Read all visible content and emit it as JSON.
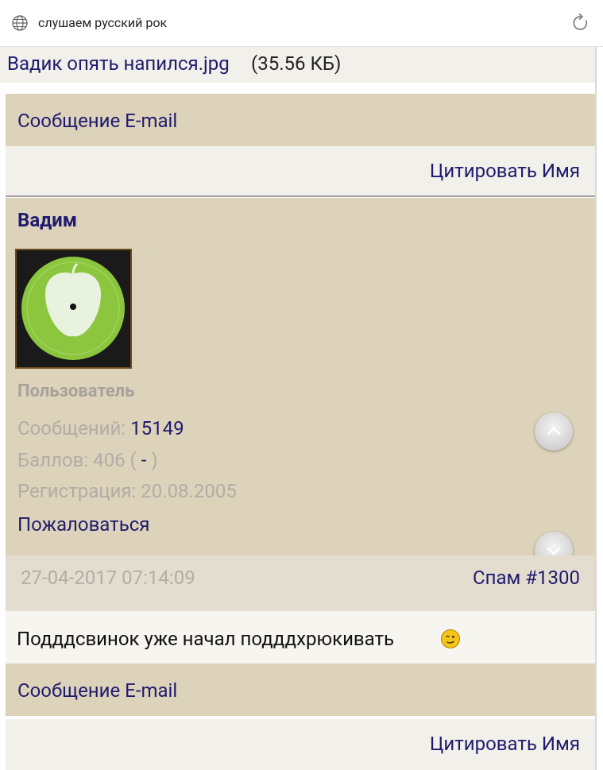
{
  "browser": {
    "url_text": "слушаем русский рок",
    "globe_icon": "globe-icon",
    "reload_icon": "reload-icon"
  },
  "attachment": {
    "filename": "Вадик опять напился.jpg",
    "size": "(35.56 КБ)"
  },
  "post_actions_top": {
    "contact_label": "Сообщение E-mail",
    "quote_label": "Цитировать Имя"
  },
  "author": {
    "name": "Вадим",
    "role": "Пользователь",
    "messages_label": "Сообщений:",
    "messages_value": "15149",
    "points_label": "Баллов: 406 (",
    "points_link": "-",
    "points_close": ")",
    "registration": "Регистрация: 20.08.2005",
    "report_label": "Пожаловаться"
  },
  "post": {
    "datetime": "27-04-2017 07:14:09",
    "spam_label": "Спам #1300",
    "text": "Подддсвинок уже начал подддхрюкивать"
  },
  "post_actions_bottom": {
    "contact_label": "Сообщение E-mail",
    "quote_label": "Цитировать Имя"
  },
  "colors": {
    "bar_tan": "#ddd2ba",
    "row_light": "#f1f0ea",
    "link_navy": "#1f1b6e",
    "muted": "#b2ada5"
  }
}
